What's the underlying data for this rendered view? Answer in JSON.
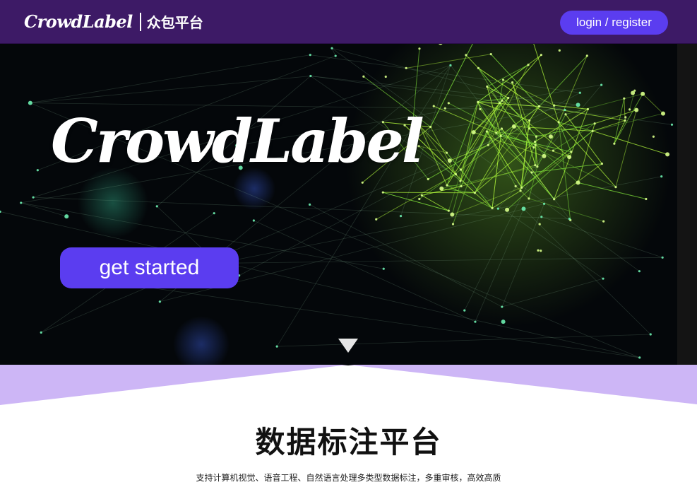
{
  "header": {
    "brand_logo": "CrowdLabel",
    "brand_sub": "众包平台",
    "login_label": "login / register"
  },
  "hero": {
    "title": "CrowdLabel",
    "cta_label": "get started",
    "arrow_icon": "chevron-down-triangle-icon"
  },
  "intro": {
    "title": "数据标注平台",
    "description": "支持计算机视觉、语音工程、自然语言处理多类型数据标注，多重审核，高效高质"
  },
  "colors": {
    "header_bg": "#3d1a66",
    "accent": "#5b3df0",
    "band": "#cdb6f6",
    "network_green": "#8bef3a"
  }
}
